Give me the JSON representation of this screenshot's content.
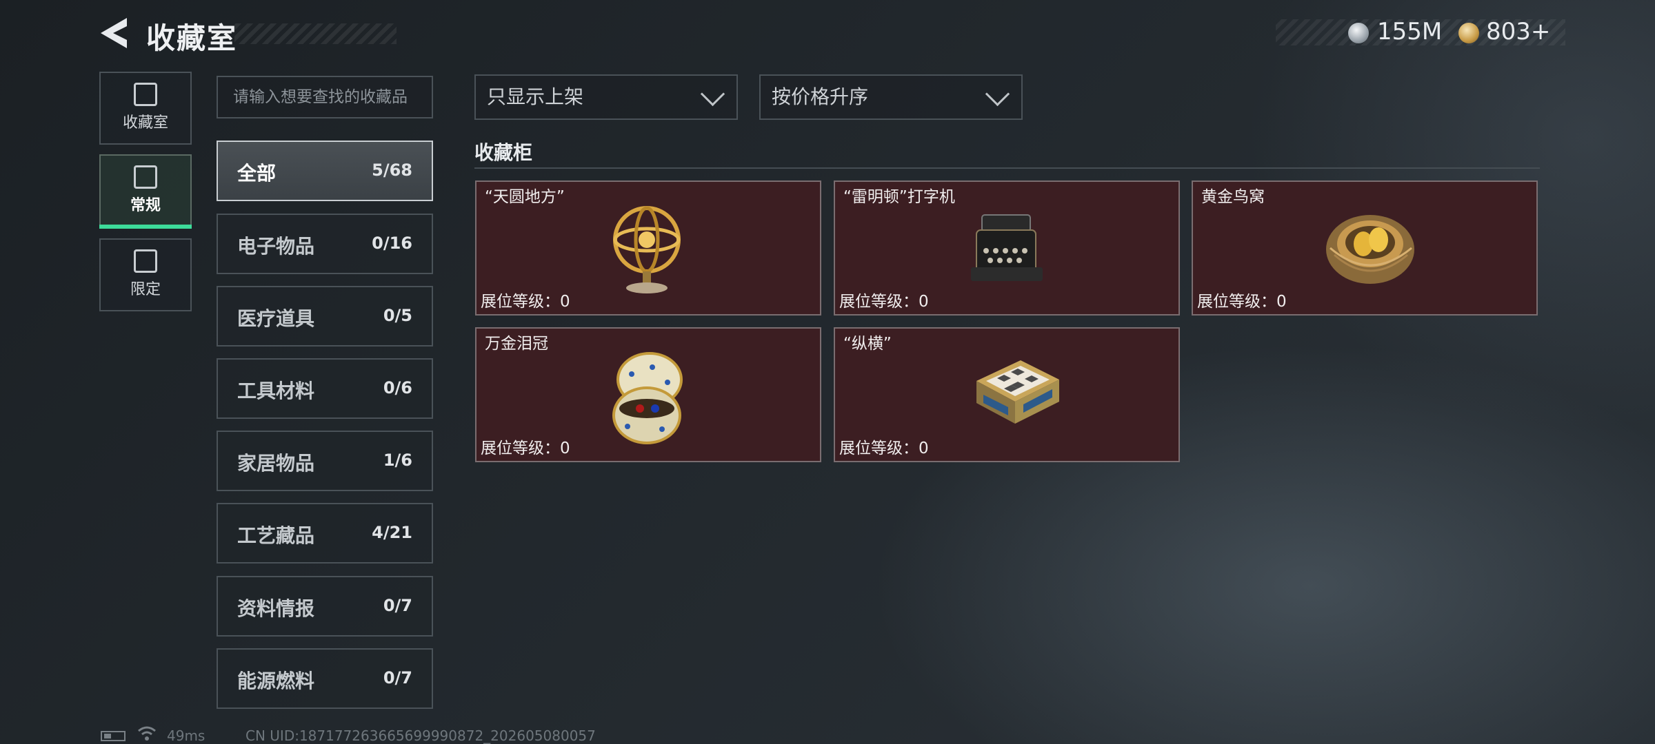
{
  "header": {
    "title": "收藏室",
    "currencies": [
      {
        "icon": "silver-coin-icon",
        "value": "155M"
      },
      {
        "icon": "gold-coin-icon",
        "value": "803+"
      }
    ]
  },
  "nav": [
    {
      "label": "收藏室",
      "icon": "collection-room-icon"
    },
    {
      "label": "常规",
      "icon": "regular-icon",
      "active": true
    },
    {
      "label": "限定",
      "icon": "limited-icon"
    }
  ],
  "search": {
    "placeholder": "请输入想要查找的收藏品"
  },
  "categories": [
    {
      "name": "全部",
      "count": "5/68",
      "active": true
    },
    {
      "name": "电子物品",
      "count": "0/16"
    },
    {
      "name": "医疗道具",
      "count": "0/5"
    },
    {
      "name": "工具材料",
      "count": "0/6"
    },
    {
      "name": "家居物品",
      "count": "1/6"
    },
    {
      "name": "工艺藏品",
      "count": "4/21"
    },
    {
      "name": "资料情报",
      "count": "0/7"
    },
    {
      "name": "能源燃料",
      "count": "0/7"
    }
  ],
  "filters": {
    "display": "只显示上架",
    "sort": "按价格升序"
  },
  "section_title": "收藏柜",
  "items": [
    {
      "name": "“天圆地方”",
      "level": "展位等级：0",
      "icon": "armillary-sphere-icon"
    },
    {
      "name": "“雷明顿”打字机",
      "level": "展位等级：0",
      "icon": "typewriter-icon"
    },
    {
      "name": "黄金鸟窝",
      "level": "展位等级：0",
      "icon": "golden-nest-icon"
    },
    {
      "name": "万金泪冠",
      "level": "展位等级：0",
      "icon": "jeweled-egg-icon"
    },
    {
      "name": "“纵横”",
      "level": "展位等级：0",
      "icon": "chess-box-icon"
    }
  ],
  "footer": {
    "ping": "49ms",
    "uid": "CN UID:187177263665699990872_202605080057"
  },
  "colors": {
    "accent": "#3ddc9a",
    "card_bg": "#3c1e22"
  }
}
